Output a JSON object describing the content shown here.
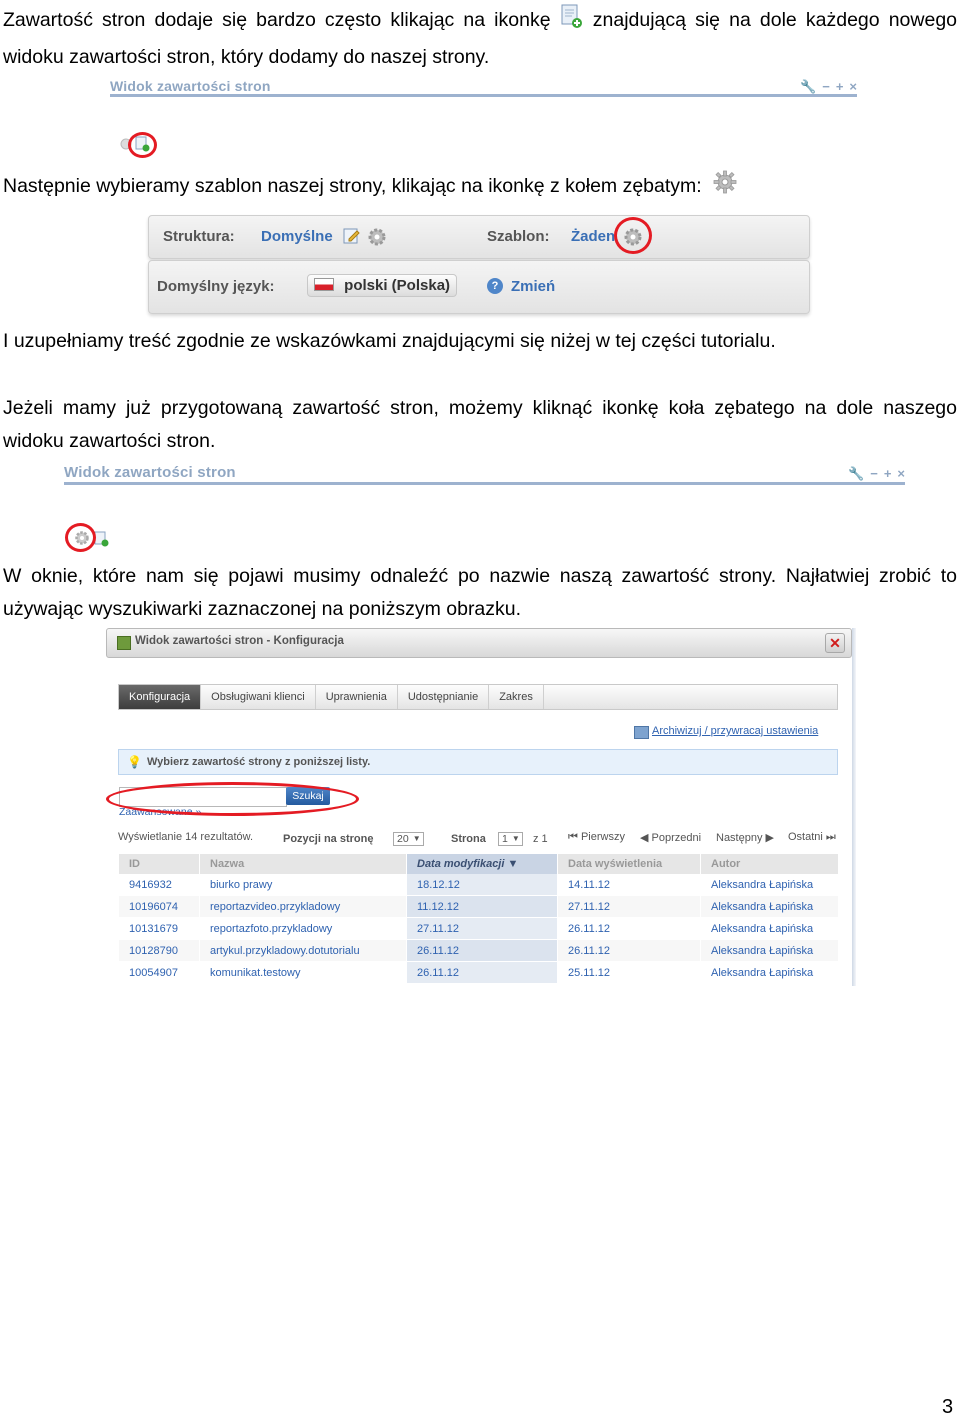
{
  "paragraphs": {
    "p1_part1": "Zawartość stron dodaje się bardzo często klikając na ikonkę",
    "p1_part2": "znajdującą się na dole każdego nowego widoku zawartości stron, który dodamy do naszej strony.",
    "p2": "Następnie wybieramy szablon naszej strony, klikając na ikonkę z kołem zębatym:",
    "p3": "I uzupełniamy treść zgodnie ze wskazówkami znajdującymi się niżej w tej części tutorialu.",
    "p4": "Jeżeli mamy już przygotowaną zawartość stron, możemy kliknąć ikonkę koła zębatego na dole naszego widoku zawartości stron.",
    "p5": "W oknie, które nam się pojawi musimy odnaleźć po nazwie naszą zawartość strony. Najłatwiej zrobić to używając wyszukiwarki zaznaczonej na poniższym obrazku."
  },
  "widget": {
    "title": "Widok zawartości stron"
  },
  "structure_panel": {
    "structure_label": "Struktura:",
    "structure_value": "Domyślne",
    "template_label": "Szablon:",
    "template_value": "Żaden",
    "language_label": "Domyślny język:",
    "language_value": "polski (Polska)",
    "change_label": "Zmień"
  },
  "dialog": {
    "title": "Widok zawartości stron - Konfiguracja",
    "tabs": [
      "Konfiguracja",
      "Obsługiwani klienci",
      "Uprawnienia",
      "Udostępnianie",
      "Zakres"
    ],
    "archive_link": "Archiwizuj / przywracaj ustawienia",
    "info": "Wybierz zawartość strony z poniższej listy.",
    "search_button": "Szukaj",
    "advanced": "Zaawansowane »",
    "results_count": "Wyświetlanie 14 rezultatów.",
    "per_page_label": "Pozycji na stronę",
    "per_page_value": "20",
    "page_label": "Strona",
    "page_value": "1",
    "page_of": "z 1",
    "first": "Pierwszy",
    "prev": "Poprzedni",
    "next": "Następny",
    "last": "Ostatni",
    "columns": [
      "ID",
      "Nazwa",
      "Data modyfikacji",
      "Data wyświetlenia",
      "Autor"
    ],
    "rows": [
      [
        "9416932",
        "biurko prawy",
        "18.12.12",
        "14.11.12",
        "Aleksandra Łapińska"
      ],
      [
        "10196074",
        "reportazvideo.przykladowy",
        "11.12.12",
        "27.11.12",
        "Aleksandra Łapińska"
      ],
      [
        "10131679",
        "reportazfoto.przykladowy",
        "27.11.12",
        "26.11.12",
        "Aleksandra Łapińska"
      ],
      [
        "10128790",
        "artykul.przykladowy.dotutorialu",
        "26.11.12",
        "26.11.12",
        "Aleksandra Łapińska"
      ],
      [
        "10054907",
        "komunikat.testowy",
        "26.11.12",
        "25.11.12",
        "Aleksandra Łapińska"
      ]
    ]
  },
  "page_number": "3",
  "colors": {
    "highlight_circle": "#e41b23",
    "link": "#2f62b0"
  }
}
